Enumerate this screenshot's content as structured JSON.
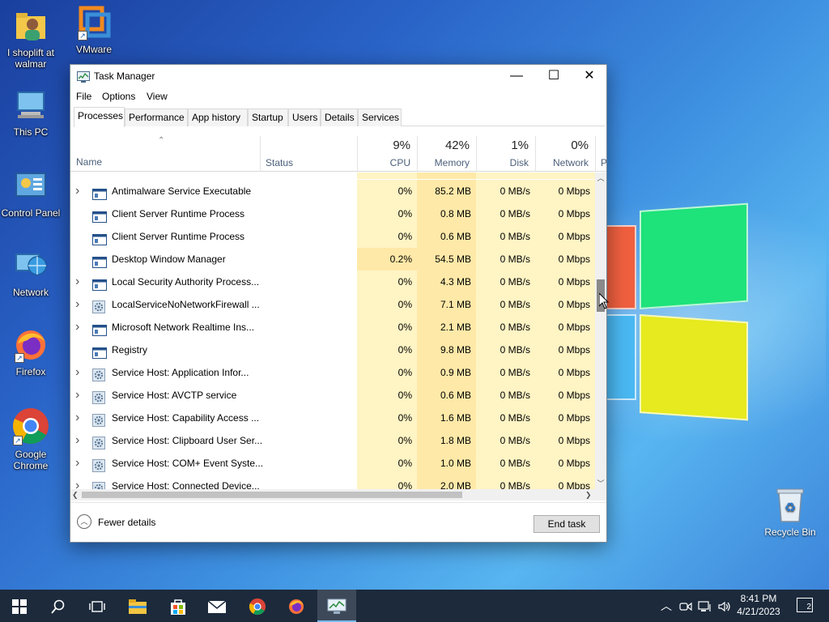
{
  "desktop": {
    "icons": [
      {
        "label": "I shoplift at walmar",
        "icon": "user-folder-icon"
      },
      {
        "label": "VMware",
        "icon": "vmware-icon"
      },
      {
        "label": "This PC",
        "icon": "computer-icon"
      },
      {
        "label": "Control Panel",
        "icon": "control-panel-icon"
      },
      {
        "label": "Network",
        "icon": "network-globe-icon"
      },
      {
        "label": "Firefox",
        "icon": "firefox-icon"
      },
      {
        "label": "Google Chrome",
        "icon": "chrome-icon"
      }
    ],
    "recycle_bin": "Recycle Bin"
  },
  "window": {
    "title": "Task Manager",
    "menu": [
      "File",
      "Options",
      "View"
    ],
    "tabs": [
      "Processes",
      "Performance",
      "App history",
      "Startup",
      "Users",
      "Details",
      "Services"
    ],
    "active_tab": "Processes"
  },
  "columns": {
    "name": "Name",
    "status": "Status",
    "cpu": {
      "pct": "9%",
      "label": "CPU"
    },
    "memory": {
      "pct": "42%",
      "label": "Memory"
    },
    "disk": {
      "pct": "1%",
      "label": "Disk"
    },
    "network": {
      "pct": "0%",
      "label": "Network"
    },
    "power_partial": "P"
  },
  "processes": [
    {
      "name": "Antimalware Service Executable",
      "expand": true,
      "icon": "app-window-icon",
      "cpu": "0%",
      "mem": "85.2 MB",
      "disk": "0 MB/s",
      "net": "0 Mbps"
    },
    {
      "name": "Client Server Runtime Process",
      "expand": false,
      "icon": "app-window-icon",
      "cpu": "0%",
      "mem": "0.8 MB",
      "disk": "0 MB/s",
      "net": "0 Mbps"
    },
    {
      "name": "Client Server Runtime Process",
      "expand": false,
      "icon": "app-window-icon",
      "cpu": "0%",
      "mem": "0.6 MB",
      "disk": "0 MB/s",
      "net": "0 Mbps"
    },
    {
      "name": "Desktop Window Manager",
      "expand": false,
      "icon": "app-window-icon",
      "cpu": "0.2%",
      "mem": "54.5 MB",
      "disk": "0 MB/s",
      "net": "0 Mbps"
    },
    {
      "name": "Local Security Authority Process...",
      "expand": true,
      "icon": "app-window-icon",
      "cpu": "0%",
      "mem": "4.3 MB",
      "disk": "0 MB/s",
      "net": "0 Mbps"
    },
    {
      "name": "LocalServiceNoNetworkFirewall ...",
      "expand": true,
      "icon": "gear-icon",
      "cpu": "0%",
      "mem": "7.1 MB",
      "disk": "0 MB/s",
      "net": "0 Mbps"
    },
    {
      "name": "Microsoft Network Realtime Ins...",
      "expand": true,
      "icon": "app-window-icon",
      "cpu": "0%",
      "mem": "2.1 MB",
      "disk": "0 MB/s",
      "net": "0 Mbps"
    },
    {
      "name": "Registry",
      "expand": false,
      "icon": "app-window-icon",
      "cpu": "0%",
      "mem": "9.8 MB",
      "disk": "0 MB/s",
      "net": "0 Mbps"
    },
    {
      "name": "Service Host: Application Infor...",
      "expand": true,
      "icon": "gear-icon",
      "cpu": "0%",
      "mem": "0.9 MB",
      "disk": "0 MB/s",
      "net": "0 Mbps"
    },
    {
      "name": "Service Host: AVCTP service",
      "expand": true,
      "icon": "gear-icon",
      "cpu": "0%",
      "mem": "0.6 MB",
      "disk": "0 MB/s",
      "net": "0 Mbps"
    },
    {
      "name": "Service Host: Capability Access ...",
      "expand": true,
      "icon": "gear-icon",
      "cpu": "0%",
      "mem": "1.6 MB",
      "disk": "0 MB/s",
      "net": "0 Mbps"
    },
    {
      "name": "Service Host: Clipboard User Ser...",
      "expand": true,
      "icon": "gear-icon",
      "cpu": "0%",
      "mem": "1.8 MB",
      "disk": "0 MB/s",
      "net": "0 Mbps"
    },
    {
      "name": "Service Host: COM+ Event Syste...",
      "expand": true,
      "icon": "gear-icon",
      "cpu": "0%",
      "mem": "1.0 MB",
      "disk": "0 MB/s",
      "net": "0 Mbps"
    },
    {
      "name": "Service Host: Connected Device...",
      "expand": true,
      "icon": "gear-icon",
      "cpu": "0%",
      "mem": "2.0 MB",
      "disk": "0 MB/s",
      "net": "0 Mbps"
    }
  ],
  "footer": {
    "fewer_details": "Fewer details",
    "end_task": "End task"
  },
  "taskbar": {
    "icons": [
      "start-icon",
      "search-icon",
      "task-view-icon",
      "file-explorer-icon",
      "store-icon",
      "mail-icon",
      "chrome-icon",
      "firefox-icon",
      "task-manager-icon"
    ],
    "time": "8:41 PM",
    "date": "4/21/2023",
    "notification_count": "2"
  }
}
